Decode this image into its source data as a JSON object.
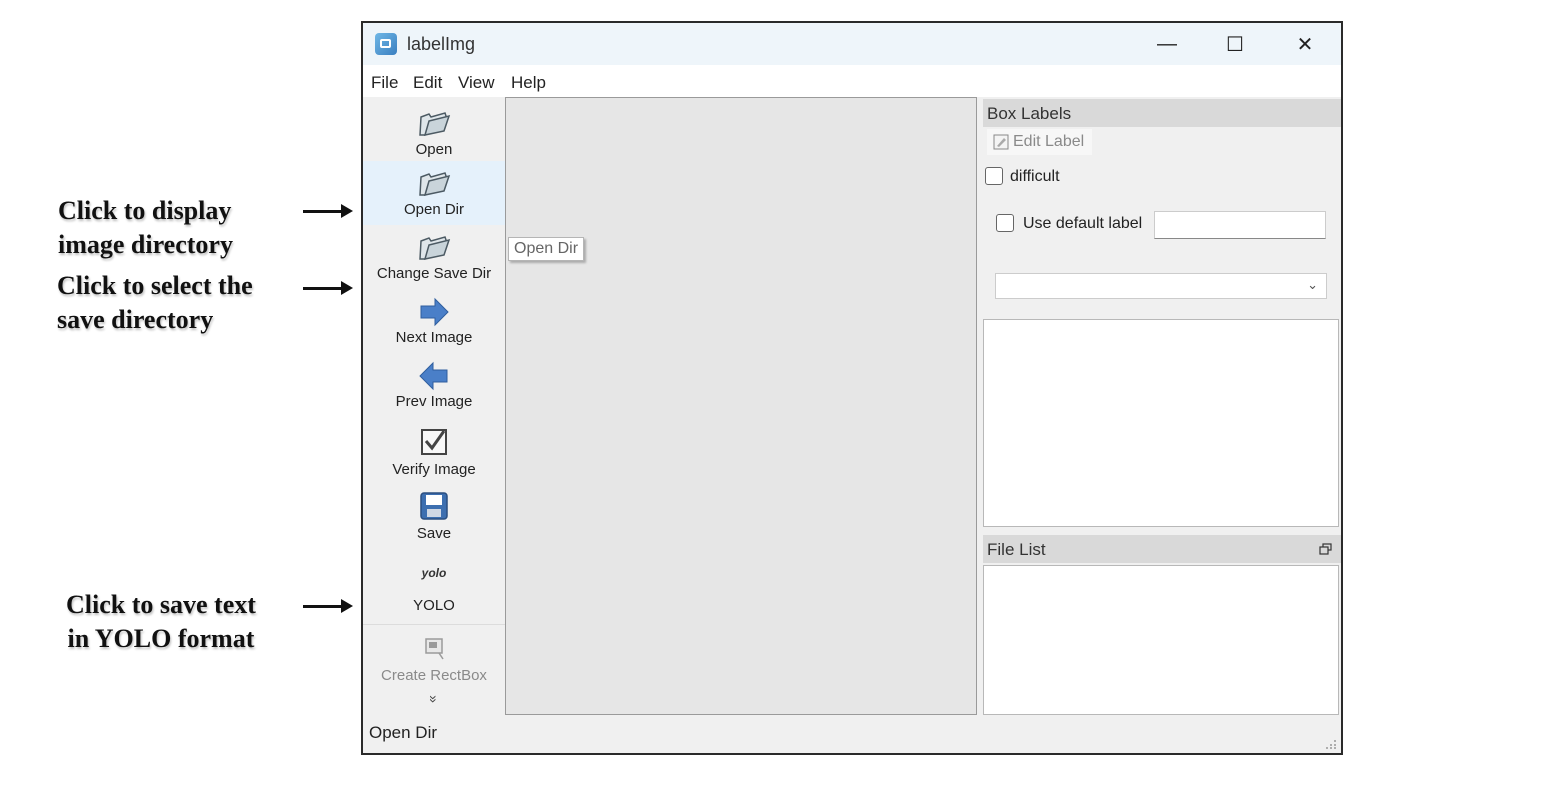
{
  "annotations": [
    {
      "text": "Click to display\nimage directory"
    },
    {
      "text": "Click to select the\nsave directory"
    },
    {
      "text": "Click to save text\nin YOLO format"
    }
  ],
  "window": {
    "title": "labelImg",
    "controls": {
      "minimize": "—",
      "maximize": "☐",
      "close": "✕"
    }
  },
  "menu": [
    "File",
    "Edit",
    "View",
    "Help"
  ],
  "toolbar": [
    {
      "label": "Open",
      "icon": "folder-icon"
    },
    {
      "label": "Open Dir",
      "icon": "folder-icon"
    },
    {
      "label": "Change Save Dir",
      "icon": "folder-icon"
    },
    {
      "label": "Next Image",
      "icon": "arrow-right-icon"
    },
    {
      "label": "Prev Image",
      "icon": "arrow-left-icon"
    },
    {
      "label": "Verify Image",
      "icon": "checkbox-icon"
    },
    {
      "label": "Save",
      "icon": "floppy-icon"
    },
    {
      "label": "YOLO",
      "icon_text": "yolo"
    },
    {
      "label": "Create RectBox",
      "icon": "rectbox-icon"
    }
  ],
  "toolbar_more": "»",
  "tooltip": "Open Dir",
  "box_labels": {
    "title": "Box Labels",
    "edit_label": "Edit Label",
    "difficult": "difficult",
    "use_default_label": "Use default label",
    "default_label_value": ""
  },
  "file_list": {
    "title": "File List"
  },
  "status": "Open Dir"
}
